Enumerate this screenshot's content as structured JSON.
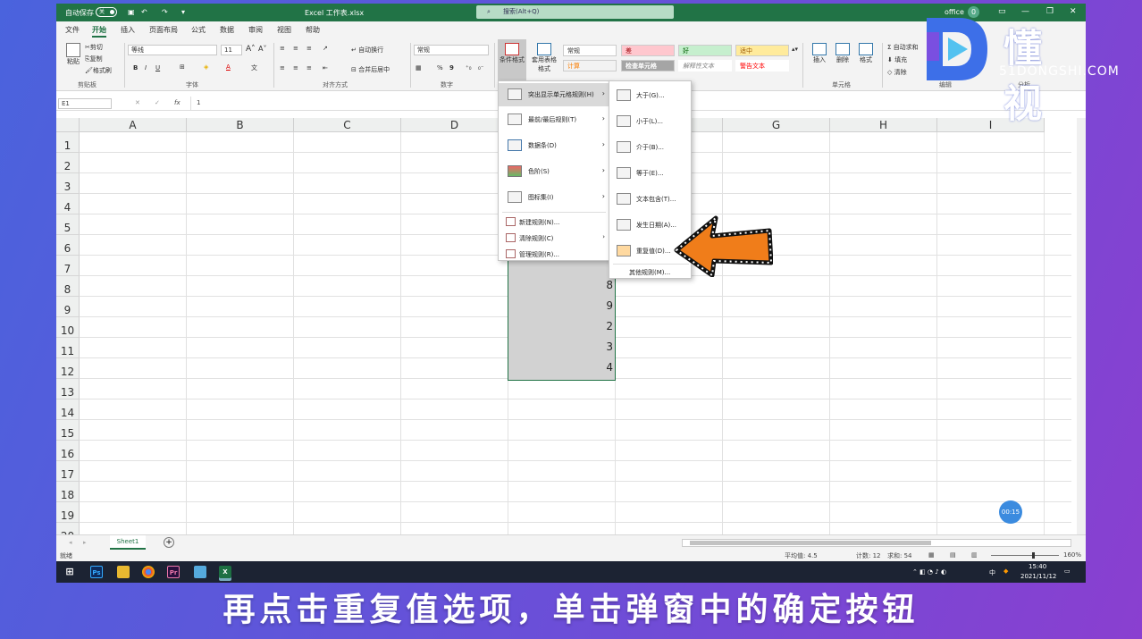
{
  "titlebar": {
    "autosave": "自动保存",
    "toggle": "关",
    "filename": "Excel 工作表.xlsx",
    "search": "搜索(Alt+Q)",
    "user": "office",
    "avatar": "0"
  },
  "menubar": {
    "items": [
      "文件",
      "开始",
      "插入",
      "页面布局",
      "公式",
      "数据",
      "审阅",
      "视图",
      "帮助"
    ],
    "active": "开始"
  },
  "ribbon": {
    "clipboard": {
      "paste": "粘贴",
      "cut": "剪切",
      "copy": "复制",
      "painter": "格式刷",
      "label": "剪贴板"
    },
    "font": {
      "name": "等线",
      "size": "11",
      "label": "字体",
      "bold": "B",
      "italic": "I",
      "underline": "U"
    },
    "align": {
      "wrap": "自动换行",
      "merge": "合并后居中",
      "label": "对齐方式"
    },
    "number": {
      "format": "常规",
      "label": "数字",
      "percent": "%",
      "comma": "9"
    },
    "styles": {
      "cond": "条件格式",
      "table": "套用表格格式",
      "normal": "常规",
      "bad": "差",
      "good": "好",
      "neutral": "适中",
      "calc": "计算",
      "check": "检查单元格",
      "explain": "解释性文本",
      "warn": "警告文本"
    },
    "cells": {
      "insert": "插入",
      "delete": "删除",
      "format": "格式",
      "label": "单元格"
    },
    "edit": {
      "autosum": "自动求和",
      "fill": "填充",
      "clear": "清除",
      "label": "编辑"
    },
    "analysis": {
      "label": "分析"
    }
  },
  "formula": {
    "namebox": "E1",
    "fx": "fx",
    "value": "1"
  },
  "columns": [
    "A",
    "B",
    "C",
    "D",
    "E",
    "F",
    "G",
    "H",
    "I"
  ],
  "rows": [
    "1",
    "2",
    "3",
    "4",
    "5",
    "6",
    "7",
    "8",
    "9",
    "10",
    "11",
    "12",
    "13",
    "14",
    "15",
    "16",
    "17",
    "18",
    "19",
    "20"
  ],
  "cells": {
    "r8": "8",
    "r9": "9",
    "r10": "2",
    "r11": "3",
    "r12": "4"
  },
  "menu": {
    "items": [
      "突出显示单元格规则(H)",
      "最前/最后规则(T)",
      "数据条(D)",
      "色阶(S)",
      "图标集(I)"
    ],
    "small": [
      "新建规则(N)...",
      "清除规则(C)",
      "管理规则(R)..."
    ]
  },
  "submenu": {
    "items": [
      "大于(G)...",
      "小于(L)...",
      "介于(B)...",
      "等于(E)...",
      "文本包含(T)...",
      "发生日期(A)...",
      "重复值(D)..."
    ],
    "other": "其他规则(M)..."
  },
  "sheet": {
    "tab": "Sheet1",
    "add": "+"
  },
  "status": {
    "ready": "就绪",
    "avg": "平均值: 4.5",
    "count": "计数: 12",
    "sum": "求和: 54",
    "zoom": "160%"
  },
  "taskbar": {
    "time": "15:40",
    "date": "2021/11/12",
    "ime": "中"
  },
  "timer": "00:15",
  "watermark": {
    "cn": "懂 视",
    "en": "51DONGSHI.COM"
  },
  "subtitle": "再点击重复值选项，单击弹窗中的确定按钮",
  "colors": {
    "excel_green": "#217346",
    "accent_arrow": "#f07d1a",
    "subtitle_bg": "#6a4fd8"
  }
}
